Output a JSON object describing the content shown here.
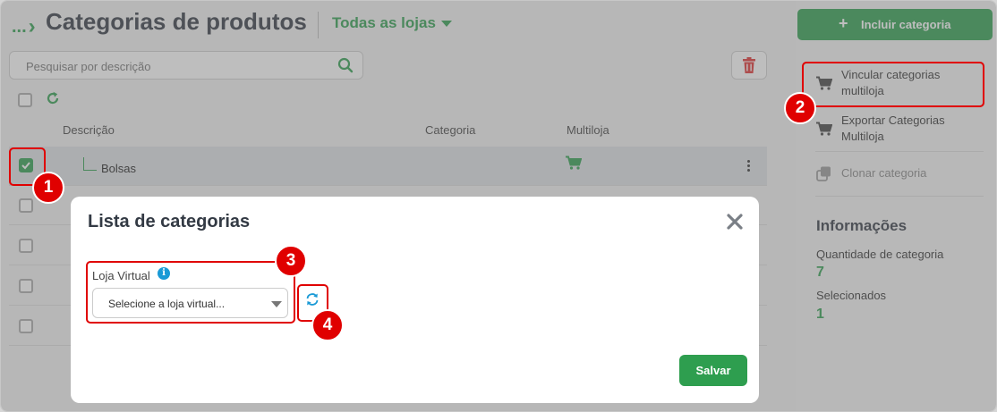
{
  "header": {
    "breadcrumb": "...",
    "title": "Categorias de produtos",
    "store_selector": "Todas as lojas"
  },
  "toolbar": {
    "search_placeholder": "Pesquisar por descrição"
  },
  "table": {
    "columns": [
      "Descrição",
      "Categoria",
      "Multiloja"
    ],
    "rows": [
      {
        "descricao": "Bolsas",
        "selected": true
      }
    ]
  },
  "sidebar": {
    "include_button": "Incluir categoria",
    "menu": [
      {
        "label": "Vincular categorias multiloja",
        "icon": "cart-icon"
      },
      {
        "label": "Exportar Categorias Multiloja",
        "icon": "cart-icon"
      },
      {
        "label": "Clonar categoria",
        "icon": "clone-icon"
      }
    ],
    "info": {
      "title": "Informações",
      "quantity_label": "Quantidade de categoria",
      "quantity_value": "7",
      "selected_label": "Selecionados",
      "selected_value": "1"
    }
  },
  "modal": {
    "title": "Lista de categorias",
    "field_label": "Loja Virtual",
    "select_placeholder": "Selecione a loja virtual...",
    "save_button": "Salvar"
  },
  "annotations": [
    "1",
    "2",
    "3",
    "4"
  ],
  "colors": {
    "accent": "#2e9e4f",
    "annotation": "#e00000",
    "info": "#1a9ad6"
  }
}
